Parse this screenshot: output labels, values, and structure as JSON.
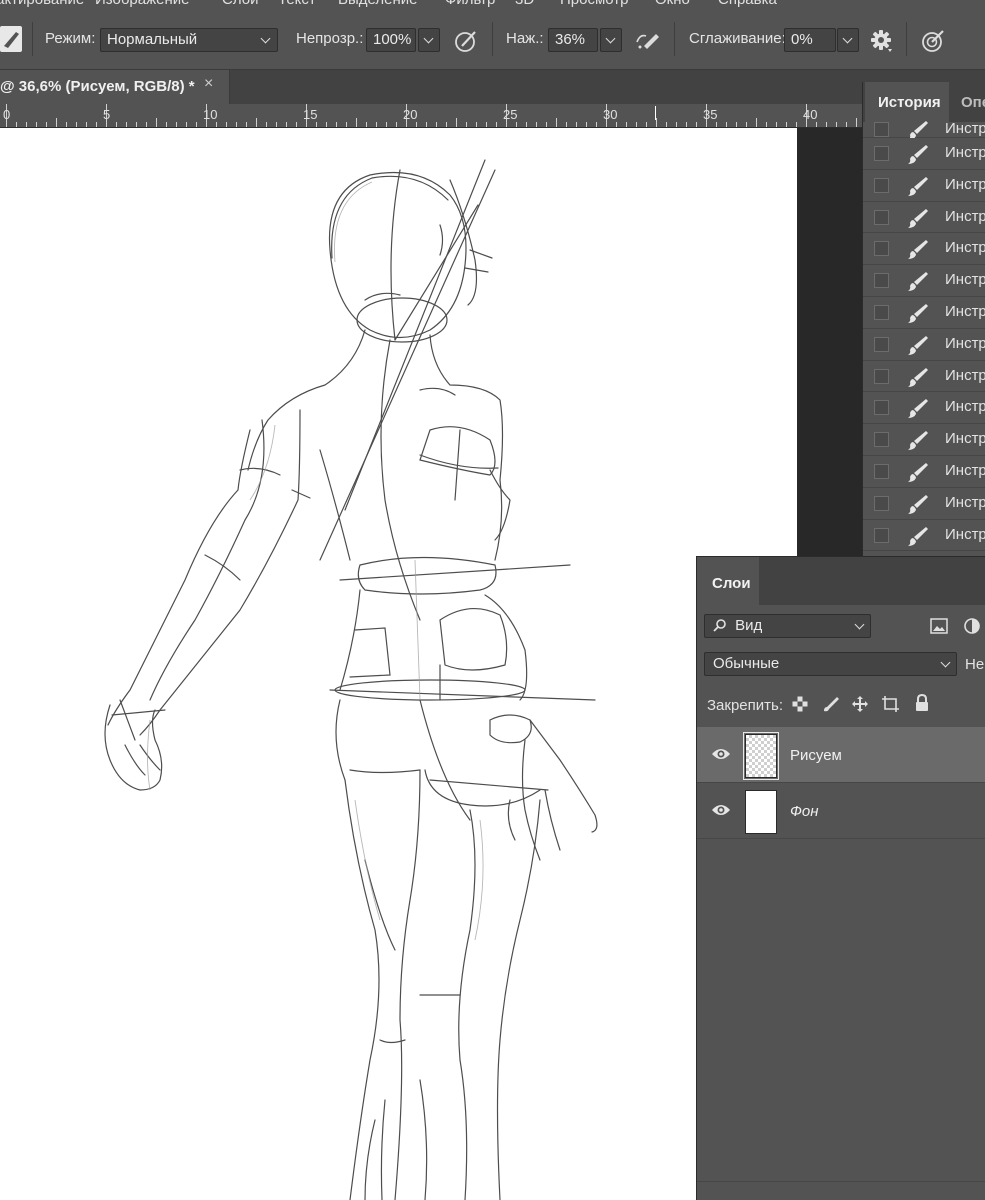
{
  "menu": {
    "items": [
      "Редактирование",
      "Изображение",
      "Слои",
      "Текст",
      "Выделение",
      "Фильтр",
      "3D",
      "Просмотр",
      "Окно",
      "Справка"
    ]
  },
  "options": {
    "mode_label": "Режим:",
    "mode_value": "Нормальный",
    "opacity_label": "Непрозр.:",
    "opacity_value": "100%",
    "pressure_label": "Наж.:",
    "pressure_value": "36%",
    "smoothing_label": "Сглаживание:",
    "smoothing_value": "0%"
  },
  "document": {
    "tab_title": "@ 36,6% (Рисуем, RGB/8) *",
    "close_glyph": "×"
  },
  "ruler": {
    "labels": [
      "0",
      "5",
      "10",
      "15",
      "20",
      "25",
      "30",
      "35",
      "40"
    ]
  },
  "history": {
    "tab_active": "История",
    "tab_other": "Опе",
    "item_label": "Инструмент \"Кисть\"",
    "item_count": 14
  },
  "layers": {
    "tab_active": "Слои",
    "filter_value": "Вид",
    "blend_value": "Обычные",
    "opacity_cut": "Неп",
    "lock_label": "Закрепить:",
    "items": [
      {
        "name": "Рисуем",
        "active": true,
        "transparent": true,
        "italic": false
      },
      {
        "name": "Фон",
        "active": false,
        "transparent": false,
        "italic": true
      }
    ]
  },
  "colors": {
    "panel": "#535353",
    "panel_dark": "#424242",
    "workspace": "#282828",
    "active_layer": "#6a6a6a",
    "canvas": "#ffffff"
  }
}
